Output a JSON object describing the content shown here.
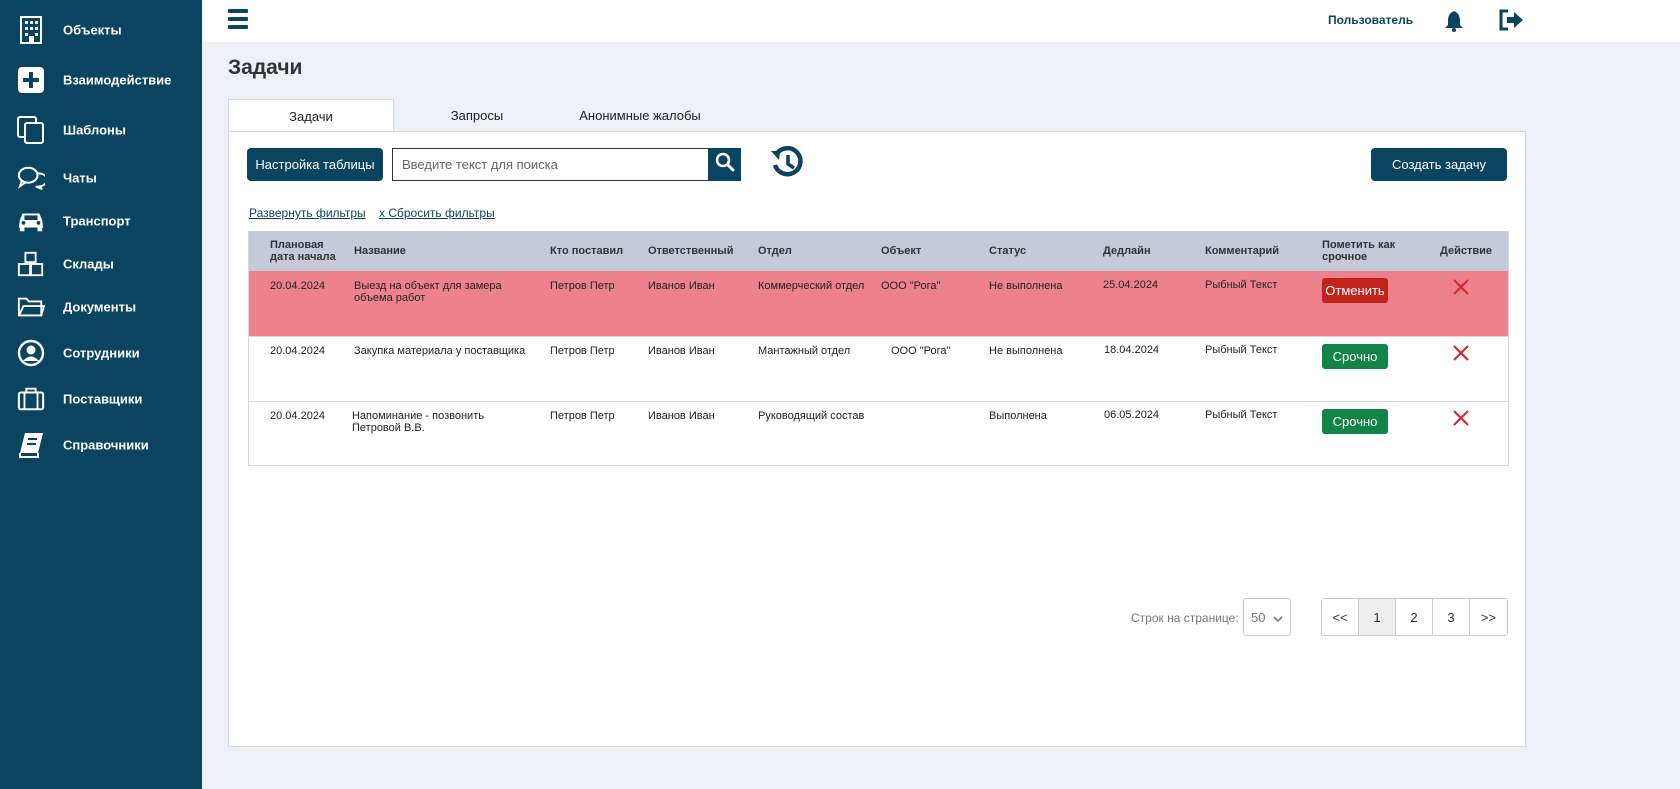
{
  "sidebar": {
    "items": [
      {
        "label": "Объекты",
        "icon": "building-icon"
      },
      {
        "label": "Взаимодействие",
        "icon": "plus-square-icon"
      },
      {
        "label": "Шаблоны",
        "icon": "copy-icon"
      },
      {
        "label": "Чаты",
        "icon": "chat-icon"
      },
      {
        "label": "Транспорт",
        "icon": "car-icon"
      },
      {
        "label": "Склады",
        "icon": "boxes-icon"
      },
      {
        "label": "Документы",
        "icon": "folder-icon"
      },
      {
        "label": "Сотрудники",
        "icon": "user-icon"
      },
      {
        "label": "Поставщики",
        "icon": "briefcase-icon"
      },
      {
        "label": "Справочники",
        "icon": "book-icon"
      }
    ]
  },
  "header": {
    "user_label": "Пользователь"
  },
  "page": {
    "title": "Задачи"
  },
  "tabs": [
    "Задачи",
    "Запросы",
    "Анонимные жалобы"
  ],
  "toolbar": {
    "table_settings": "Настройка таблицы",
    "search_placeholder": "Введите текст для поиска",
    "create_task": "Создать задачу",
    "expand_filters": "Развернуть фильтры",
    "reset_filters": "x Сбросить фильтры"
  },
  "table": {
    "headers": {
      "start_date_1": "Плановая",
      "start_date_2": "дата начала",
      "name": "Название",
      "author": "Кто поставил",
      "responsible": "Ответственный",
      "department": "Отдел",
      "object": "Объект",
      "status": "Статус",
      "deadline": "Дедлайн",
      "comment": "Комментарий",
      "urgent_1": "Пометить как",
      "urgent_2": "срочное",
      "action": "Действие"
    },
    "rows": [
      {
        "start": "20.04.2024",
        "name_1": "Выезд на объект для замера",
        "name_2": "объема работ",
        "author": "Петров Петр",
        "responsible": "Иванов Иван",
        "department": "Коммерческий отдел",
        "object": "ООО \"Рога\"",
        "status": "Не выполнена",
        "deadline": "25.04.2024",
        "comment": "Рыбный Текст",
        "button": "Отменить"
      },
      {
        "start": "20.04.2024",
        "name_1": "Закупка материала у поставщика",
        "name_2": "",
        "author": "Петров Петр",
        "responsible": "Иванов Иван",
        "department": "Мантажный отдел",
        "object": "ООО \"Рога\"",
        "status": "Не выполнена",
        "deadline": "18.04.2024",
        "comment": "Рыбный Текст",
        "button": "Срочно"
      },
      {
        "start": "20.04.2024",
        "name_1": "Напоминание - позвонить",
        "name_2": "Петровой В.В.",
        "author": "Петров Петр",
        "responsible": "Иванов Иван",
        "department": "Руководящий состав",
        "object": "",
        "status": "Выполнена",
        "deadline": "06.05.2024",
        "comment": "Рыбный Текст",
        "button": "Срочно"
      }
    ]
  },
  "pagination": {
    "rows_label": "Строк на странице:",
    "rows_value": "50",
    "first": "<<",
    "pages": [
      "1",
      "2",
      "3"
    ],
    "last": ">>",
    "current": "1"
  },
  "colors": {
    "primary": "#0a4461",
    "danger_row": "#ee828c",
    "cancel": "#c2241c",
    "urgent": "#128447",
    "delete": "#d9242f"
  }
}
